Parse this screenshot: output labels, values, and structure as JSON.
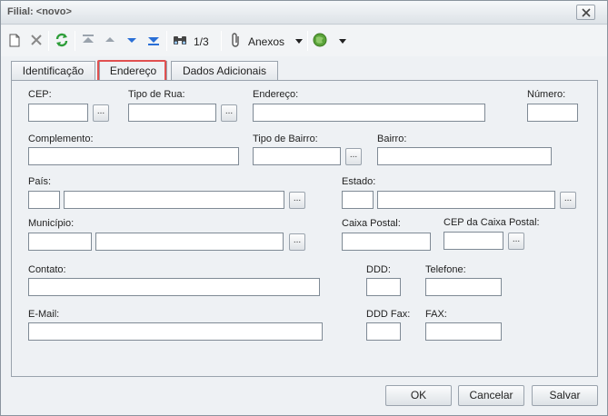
{
  "window": {
    "title": "Filial: <novo>"
  },
  "toolbar": {
    "record_counter": "1/3",
    "attachments_label": "Anexos"
  },
  "tabs": [
    {
      "label": "Identificação"
    },
    {
      "label": "Endereço"
    },
    {
      "label": "Dados Adicionais"
    }
  ],
  "form": {
    "cep": {
      "label": "CEP:",
      "value": ""
    },
    "tipo_rua": {
      "label": "Tipo de Rua:",
      "value": ""
    },
    "endereco": {
      "label": "Endereço:",
      "value": ""
    },
    "numero": {
      "label": "Número:",
      "value": ""
    },
    "complemento": {
      "label": "Complemento:",
      "value": ""
    },
    "tipo_bairro": {
      "label": "Tipo de Bairro:",
      "value": ""
    },
    "bairro": {
      "label": "Bairro:",
      "value": ""
    },
    "pais": {
      "label": "País:",
      "code": "",
      "name": ""
    },
    "estado": {
      "label": "Estado:",
      "code": "",
      "name": ""
    },
    "municipio": {
      "label": "Município:",
      "code": "",
      "name": ""
    },
    "caixa_postal": {
      "label": "Caixa Postal:",
      "value": ""
    },
    "cep_caixa_postal": {
      "label": "CEP da Caixa Postal:",
      "value": ""
    },
    "contato": {
      "label": "Contato:",
      "value": ""
    },
    "ddd": {
      "label": "DDD:",
      "value": ""
    },
    "telefone": {
      "label": "Telefone:",
      "value": ""
    },
    "email": {
      "label": "E-Mail:",
      "value": ""
    },
    "ddd_fax": {
      "label": "DDD Fax:",
      "value": ""
    },
    "fax": {
      "label": "FAX:",
      "value": ""
    },
    "ellipsis": "..."
  },
  "buttons": {
    "ok": "OK",
    "cancel": "Cancelar",
    "save": "Salvar"
  },
  "colors": {
    "tab_highlight": "#e05050",
    "refresh_icon": "#2e9e3a",
    "nav_icon": "#2a6fd6"
  }
}
